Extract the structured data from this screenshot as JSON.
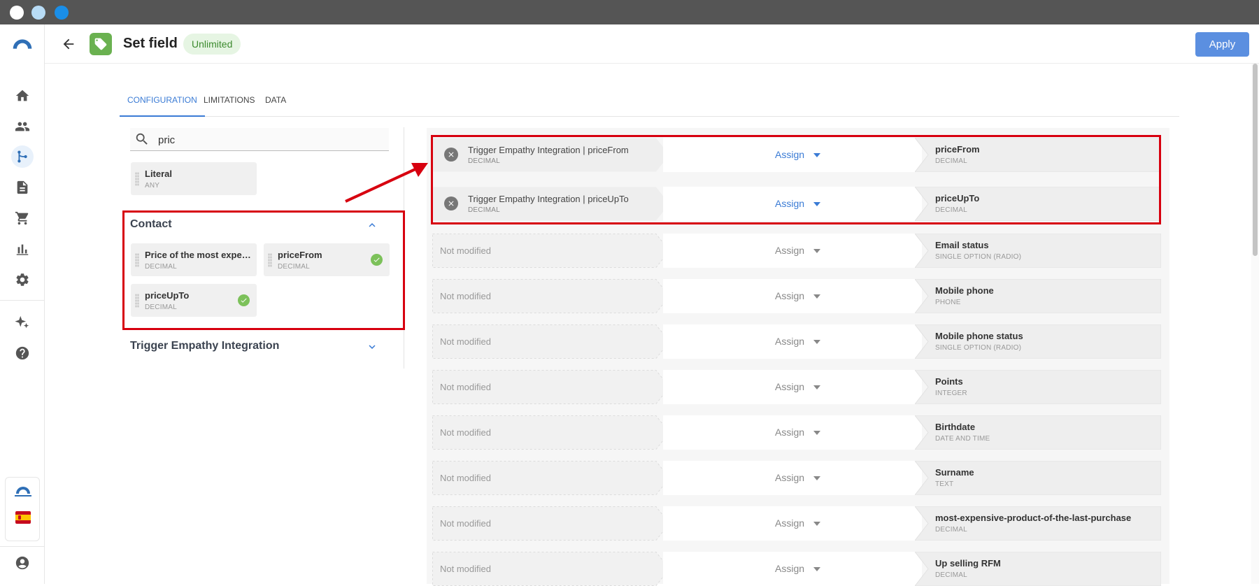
{
  "window": {
    "dots": [
      {
        "color": "#ffffff"
      },
      {
        "color": "#b8dcf6"
      },
      {
        "color": "#1a8ee8"
      }
    ]
  },
  "header": {
    "title": "Set field",
    "badge": "Unlimited",
    "apply_label": "Apply"
  },
  "tabs": [
    {
      "label": "CONFIGURATION",
      "active": true
    },
    {
      "label": "LIMITATIONS",
      "active": false
    },
    {
      "label": "DATA",
      "active": false
    }
  ],
  "search": {
    "value": "pric",
    "icon": "search-icon"
  },
  "literal": {
    "name": "Literal",
    "type": "ANY"
  },
  "contact": {
    "title": "Contact",
    "fields": [
      {
        "name": "Price of the most expe…",
        "type": "DECIMAL",
        "used": false
      },
      {
        "name": "priceFrom",
        "type": "DECIMAL",
        "used": true
      },
      {
        "name": "priceUpTo",
        "type": "DECIMAL",
        "used": true
      }
    ]
  },
  "trigger_section": {
    "title": "Trigger Empathy Integration"
  },
  "mappings": [
    {
      "source": "Trigger Empathy Integration | priceFrom",
      "source_type": "DECIMAL",
      "action": "Assign",
      "target": "priceFrom",
      "target_type": "DECIMAL",
      "modified": true
    },
    {
      "source": "Trigger Empathy Integration | priceUpTo",
      "source_type": "DECIMAL",
      "action": "Assign",
      "target": "priceUpTo",
      "target_type": "DECIMAL",
      "modified": true
    },
    {
      "source": "Not modified",
      "source_type": "",
      "action": "Assign",
      "target": "Email status",
      "target_type": "SINGLE OPTION (RADIO)",
      "modified": false
    },
    {
      "source": "Not modified",
      "source_type": "",
      "action": "Assign",
      "target": "Mobile phone",
      "target_type": "PHONE",
      "modified": false
    },
    {
      "source": "Not modified",
      "source_type": "",
      "action": "Assign",
      "target": "Mobile phone status",
      "target_type": "SINGLE OPTION (RADIO)",
      "modified": false
    },
    {
      "source": "Not modified",
      "source_type": "",
      "action": "Assign",
      "target": "Points",
      "target_type": "INTEGER",
      "modified": false
    },
    {
      "source": "Not modified",
      "source_type": "",
      "action": "Assign",
      "target": "Birthdate",
      "target_type": "DATE AND TIME",
      "modified": false
    },
    {
      "source": "Not modified",
      "source_type": "",
      "action": "Assign",
      "target": "Surname",
      "target_type": "TEXT",
      "modified": false
    },
    {
      "source": "Not modified",
      "source_type": "",
      "action": "Assign",
      "target": "most-expensive-product-of-the-last-purchase",
      "target_type": "DECIMAL",
      "modified": false
    },
    {
      "source": "Not modified",
      "source_type": "",
      "action": "Assign",
      "target": "Up selling RFM",
      "target_type": "DECIMAL",
      "modified": false
    }
  ],
  "colors": {
    "accent": "#3a7bd5",
    "apply": "#5b8fe0",
    "highlight": "#d7000f",
    "success": "#7cc15a",
    "tag": "#6ab150"
  }
}
